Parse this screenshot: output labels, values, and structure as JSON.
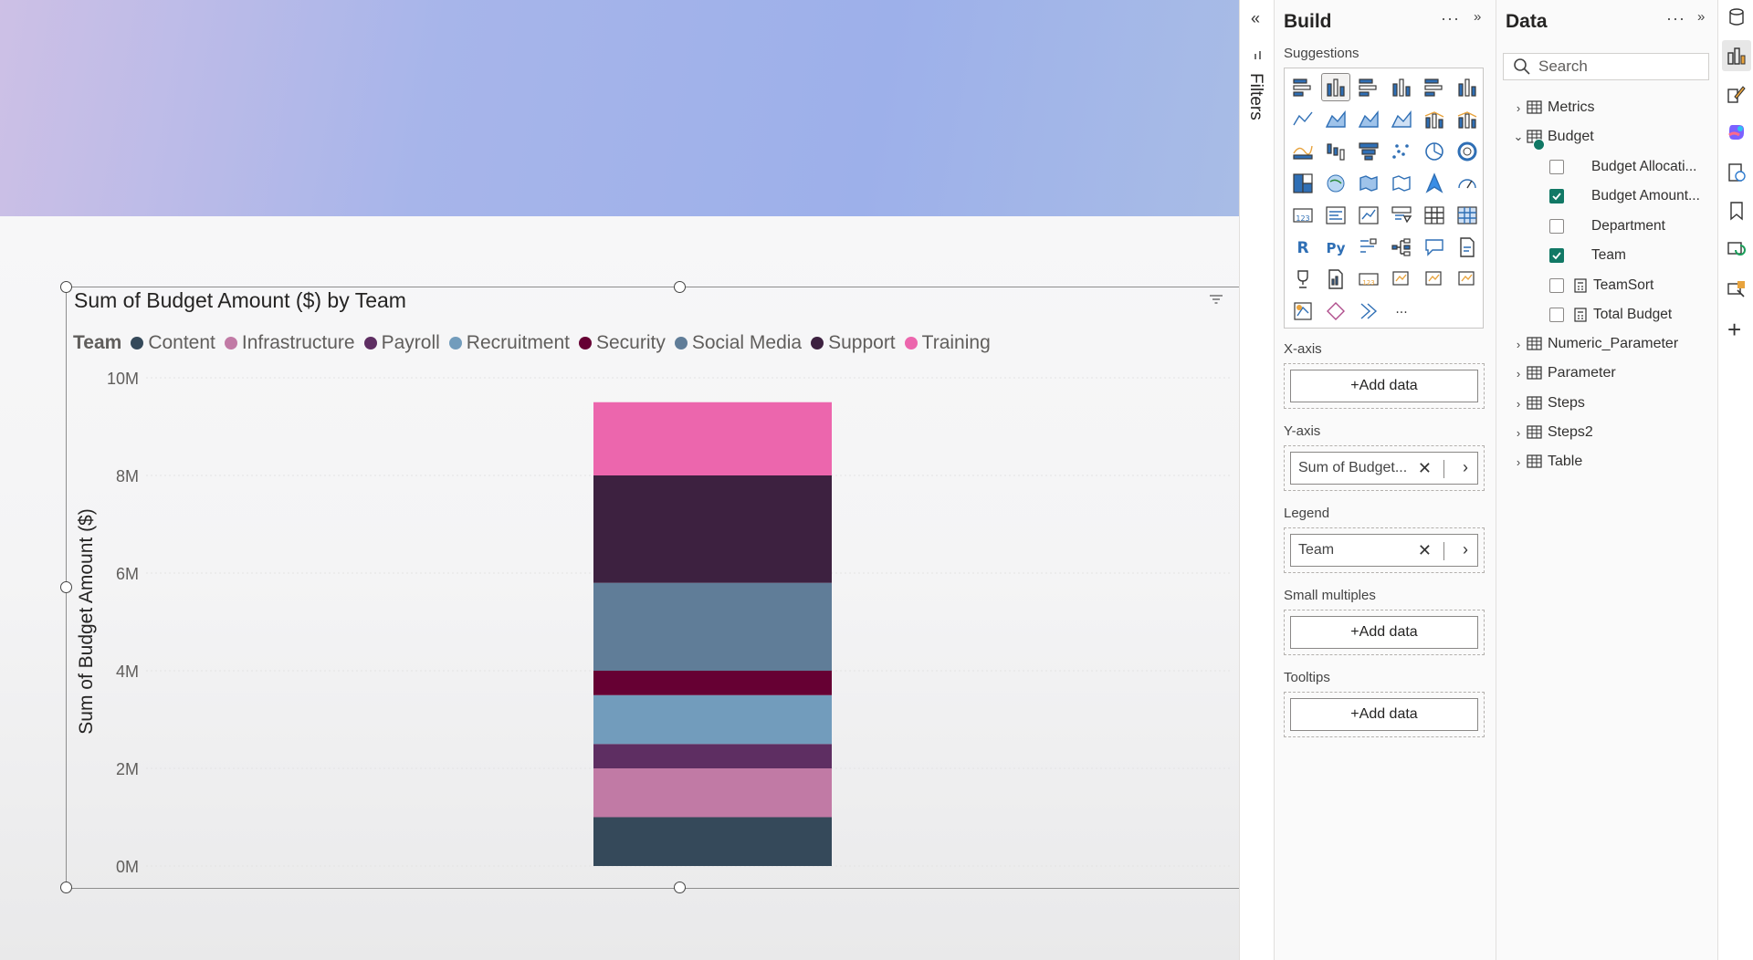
{
  "visual": {
    "title": "Sum of Budget Amount ($) by Team",
    "legend_title": "Team"
  },
  "chart_data": {
    "type": "bar",
    "stacked": true,
    "title": "Sum of Budget Amount ($) by Team",
    "xlabel": "",
    "ylabel": "Sum of Budget Amount ($)",
    "ylim": [
      0,
      10000000
    ],
    "y_ticks": [
      "0M",
      "2M",
      "4M",
      "6M",
      "8M",
      "10M"
    ],
    "y_tick_values": [
      0,
      2000000,
      4000000,
      6000000,
      8000000,
      10000000
    ],
    "grid": true,
    "legend_position": "top-left",
    "categories": [
      ""
    ],
    "series": [
      {
        "name": "Content",
        "values": [
          1000000
        ],
        "color": "#35495a"
      },
      {
        "name": "Infrastructure",
        "values": [
          1000000
        ],
        "color": "#c17aa5"
      },
      {
        "name": "Payroll",
        "values": [
          500000
        ],
        "color": "#5e2e62"
      },
      {
        "name": "Recruitment",
        "values": [
          1000000
        ],
        "color": "#729cbc"
      },
      {
        "name": "Security",
        "values": [
          500000
        ],
        "color": "#660033"
      },
      {
        "name": "Social Media",
        "values": [
          1800000
        ],
        "color": "#607d98"
      },
      {
        "name": "Support",
        "values": [
          2200000
        ],
        "color": "#3d2140"
      },
      {
        "name": "Training",
        "values": [
          1500000
        ],
        "color": "#ec66ad"
      }
    ]
  },
  "filters": {
    "label": "Filters"
  },
  "build": {
    "title": "Build",
    "more": "···",
    "suggestions_label": "Suggestions",
    "viz_icons": [
      "stacked-bar-chart",
      "stacked-column-chart",
      "clustered-bar-chart",
      "clustered-column-chart",
      "100-stacked-bar-chart",
      "100-stacked-column-chart",
      "line-chart",
      "area-chart",
      "stacked-area-chart",
      "100-stacked-area-chart",
      "line-clustered-column-chart",
      "line-stacked-column-chart",
      "ribbon-chart",
      "waterfall-chart",
      "funnel-chart",
      "scatter-chart",
      "pie-chart",
      "donut-chart",
      "treemap",
      "map",
      "filled-map",
      "shape-map",
      "azure-map",
      "gauge",
      "card",
      "multi-row-card",
      "kpi",
      "slicer",
      "table",
      "matrix",
      "r-visual",
      "python-visual",
      "key-influencers",
      "decomposition-tree",
      "qa-visual",
      "paginated-report",
      "trophy",
      "smart-narrative",
      "metrics",
      "power-apps",
      "power-automate",
      "filter-visual",
      "custom-visual-1",
      "custom-visual-2",
      "custom-visual-3",
      "more-visuals"
    ],
    "r_label": "R",
    "py_label": "Py",
    "wells": {
      "xaxis": {
        "label": "X-axis",
        "add": "+Add data"
      },
      "yaxis": {
        "label": "Y-axis",
        "field": "Sum of Budget..."
      },
      "legend": {
        "label": "Legend",
        "field": "Team"
      },
      "small_multiples": {
        "label": "Small multiples",
        "add": "+Add data"
      },
      "tooltips": {
        "label": "Tooltips",
        "add": "+Add data"
      }
    }
  },
  "data_pane": {
    "title": "Data",
    "more": "···",
    "search_placeholder": "Search",
    "tables": {
      "metrics": "Metrics",
      "budget": "Budget",
      "numeric_parameter": "Numeric_Parameter",
      "parameter": "Parameter",
      "steps": "Steps",
      "steps2": "Steps2",
      "table": "Table"
    },
    "budget_fields": [
      {
        "name": "Budget Allocati...",
        "checked": false
      },
      {
        "name": "Budget Amount...",
        "checked": true
      },
      {
        "name": "Department",
        "checked": false
      },
      {
        "name": "Team",
        "checked": true
      },
      {
        "name": "TeamSort",
        "checked": false
      },
      {
        "name": "Total Budget",
        "checked": false
      }
    ]
  }
}
